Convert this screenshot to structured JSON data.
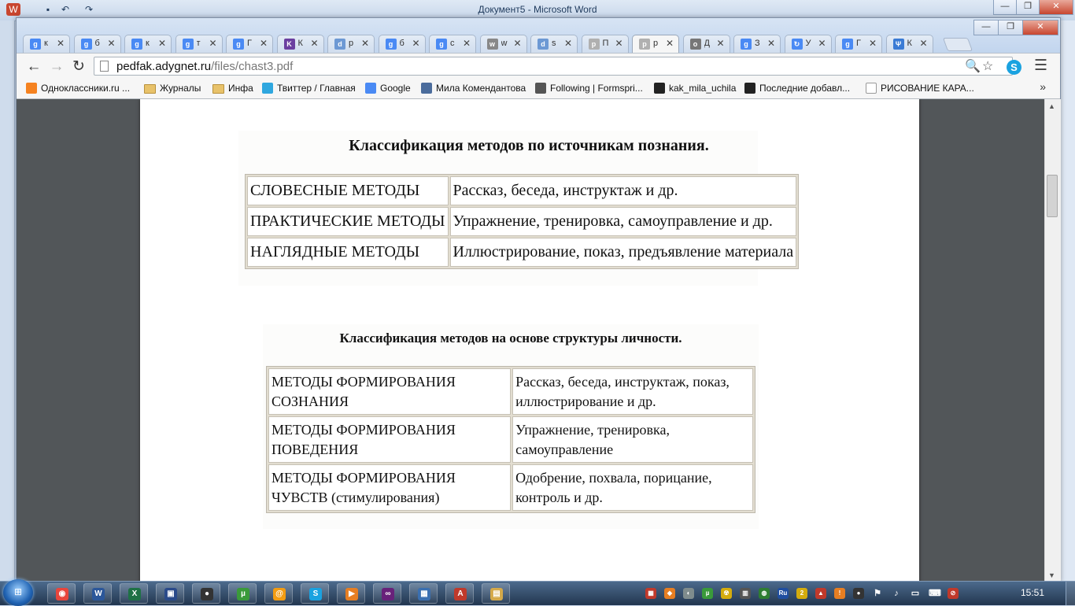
{
  "word": {
    "title": "Документ5 - Microsoft Word",
    "minimize": "—",
    "maximize": "❐",
    "close": "✕"
  },
  "chrome": {
    "window_controls": {
      "minimize": "—",
      "maximize": "❐",
      "close": "✕"
    },
    "tabs": [
      {
        "title": "к",
        "icon": "g",
        "color": "#4a8af4"
      },
      {
        "title": "б",
        "icon": "g",
        "color": "#4a8af4"
      },
      {
        "title": "к",
        "icon": "g",
        "color": "#4a8af4"
      },
      {
        "title": "т",
        "icon": "g",
        "color": "#4a8af4"
      },
      {
        "title": "Г",
        "icon": "g",
        "color": "#4a8af4"
      },
      {
        "title": "К",
        "icon": "K",
        "color": "#6b3fa0"
      },
      {
        "title": "р",
        "icon": "d",
        "color": "#6d99d4"
      },
      {
        "title": "б",
        "icon": "g",
        "color": "#4a8af4"
      },
      {
        "title": "с",
        "icon": "g",
        "color": "#4a8af4"
      },
      {
        "title": "w",
        "icon": "w",
        "color": "#888888"
      },
      {
        "title": "s",
        "icon": "d",
        "color": "#6d99d4"
      },
      {
        "title": "П",
        "icon": "p",
        "color": "#b0b0b0"
      },
      {
        "title": "р",
        "icon": "p",
        "color": "#b0b0b0"
      },
      {
        "title": "Д",
        "icon": "o",
        "color": "#777777"
      },
      {
        "title": "З",
        "icon": "g",
        "color": "#4a8af4"
      },
      {
        "title": "У",
        "icon": "↻",
        "color": "#4a8af4"
      },
      {
        "title": "Г",
        "icon": "g",
        "color": "#4a8af4"
      },
      {
        "title": "К",
        "icon": "Ψ",
        "color": "#3a7bd5"
      }
    ],
    "tab_close": "✕",
    "url_host": "pedfak.adygnet.ru",
    "url_path": "/files/chast3.pdf",
    "nav": {
      "back": "←",
      "forward": "→",
      "reload": "↻"
    },
    "icons": {
      "zoom": "🔍",
      "star": "☆",
      "skype": "S",
      "menu": "☰"
    },
    "bookmarks": [
      {
        "label": "Одноклассники.ru ...",
        "icon": "ok",
        "color": "#f58220"
      },
      {
        "label": "Журналы",
        "icon": "folder",
        "color": "#e8c26a"
      },
      {
        "label": "Инфа",
        "icon": "folder",
        "color": "#e8c26a"
      },
      {
        "label": "Твиттер / Главная",
        "icon": "bird",
        "color": "#2fa7df"
      },
      {
        "label": "Google",
        "icon": "g",
        "color": "#4a8af4"
      },
      {
        "label": "Мила Комендантова",
        "icon": "B",
        "color": "#4b6c9c"
      },
      {
        "label": "Following | Formspri...",
        "icon": "◎",
        "color": "#555555"
      },
      {
        "label": "kak_mila_uchila",
        "icon": "user",
        "color": "#222222"
      },
      {
        "label": "Последние добавл...",
        "icon": "film",
        "color": "#222222"
      },
      {
        "label": "РИСОВАНИЕ КАРА...",
        "icon": "page",
        "color": "#ffffff"
      }
    ],
    "bookmarks_more": "»"
  },
  "document": {
    "title1": "Классификация методов по источникам познания.",
    "table1": [
      [
        "СЛОВЕСНЫЕ МЕТОДЫ",
        "Рассказ, беседа, инструктаж и др."
      ],
      [
        "ПРАКТИЧЕСКИЕ МЕТОДЫ",
        "Упражнение, тренировка, самоуправление и др."
      ],
      [
        "НАГЛЯДНЫЕ МЕТОДЫ",
        "Иллюстрирование, показ, предъявление материала"
      ]
    ],
    "title2": "Классификация методов на основе структуры личности.",
    "table2": [
      [
        "МЕТОДЫ ФОРМИРОВАНИЯ СОЗНАНИЯ",
        "Рассказ, беседа, инструктаж, показ, иллюстрирование и др."
      ],
      [
        "МЕТОДЫ ФОРМИРОВАНИЯ ПОВЕДЕНИЯ",
        "Упражнение, тренировка, самоуправление"
      ],
      [
        "МЕТОДЫ ФОРМИРОВАНИЯ ЧУВСТВ (стимулирования)",
        "Одобрение, похвала, порицание, контроль и др."
      ]
    ]
  },
  "taskbar": {
    "start_logo": "⊞",
    "apps": [
      {
        "name": "chrome",
        "glyph": "◉",
        "color": "#e8453c"
      },
      {
        "name": "word",
        "glyph": "W",
        "color": "#2b579a"
      },
      {
        "name": "excel",
        "glyph": "X",
        "color": "#1e7145"
      },
      {
        "name": "save",
        "glyph": "▣",
        "color": "#2a4a8a"
      },
      {
        "name": "spy",
        "glyph": "●",
        "color": "#333333"
      },
      {
        "name": "utorrent",
        "glyph": "µ",
        "color": "#3a9a3a"
      },
      {
        "name": "mail",
        "glyph": "@",
        "color": "#f39c12"
      },
      {
        "name": "skype",
        "glyph": "S",
        "color": "#1aa2e0"
      },
      {
        "name": "player",
        "glyph": "▶",
        "color": "#e67e22"
      },
      {
        "name": "visualstudio",
        "glyph": "∞",
        "color": "#68217a"
      },
      {
        "name": "network",
        "glyph": "▦",
        "color": "#3a6fb0"
      },
      {
        "name": "acrobat",
        "glyph": "A",
        "color": "#c0392b"
      },
      {
        "name": "explorer",
        "glyph": "▤",
        "color": "#d4a94a"
      }
    ],
    "tray": [
      {
        "glyph": "▦",
        "color": "#c0392b"
      },
      {
        "glyph": "◆",
        "color": "#e67e22"
      },
      {
        "glyph": "◐",
        "color": "#7f8c8d"
      },
      {
        "glyph": "µ",
        "color": "#3a9a3a"
      },
      {
        "glyph": "☢",
        "color": "#d4ac0d"
      },
      {
        "glyph": "▥",
        "color": "#555555"
      },
      {
        "glyph": "◍",
        "color": "#2e7d32"
      },
      {
        "glyph": "Ru",
        "color": "#1f4ea0"
      },
      {
        "glyph": "2",
        "color": "#d4ac0d"
      },
      {
        "glyph": "▲",
        "color": "#c0392b"
      },
      {
        "glyph": "!",
        "color": "#e67e22"
      },
      {
        "glyph": "●",
        "color": "#333333"
      },
      {
        "glyph": "⚑",
        "color": "#dddddd"
      },
      {
        "glyph": "♪",
        "color": "#dddddd"
      },
      {
        "glyph": "▭",
        "color": "#dddddd"
      },
      {
        "glyph": "⌨",
        "color": "#dddddd"
      },
      {
        "glyph": "⊘",
        "color": "#c0392b"
      }
    ],
    "clock": "15:51"
  }
}
